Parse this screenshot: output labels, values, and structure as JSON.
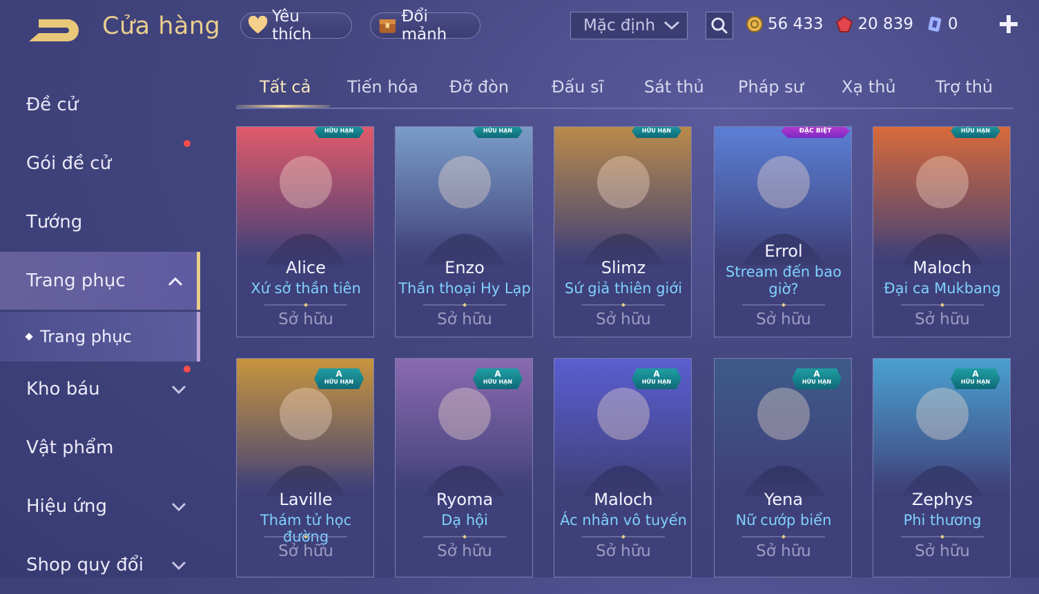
{
  "header": {
    "title": "Cửa hàng",
    "favorite_label": "Yêu thích",
    "shard_label": "Đổi mảnh",
    "sort_value": "Mặc định"
  },
  "currency": {
    "gold": "56 433",
    "vouchers": "20 839",
    "tickets": "0"
  },
  "sidebar": {
    "items": [
      {
        "label": "Đề cử"
      },
      {
        "label": "Gói đề cử"
      },
      {
        "label": "Tướng"
      },
      {
        "label": "Trang phục"
      },
      {
        "label": "Kho báu"
      },
      {
        "label": "Vật phẩm"
      },
      {
        "label": "Hiệu ứng"
      },
      {
        "label": "Shop quy đổi"
      }
    ],
    "sub_item": "Trang phục"
  },
  "tabs": [
    "Tất cả",
    "Tiến hóa",
    "Đỡ đòn",
    "Đấu sĩ",
    "Sát thủ",
    "Pháp sư",
    "Xạ thủ",
    "Trợ thủ"
  ],
  "cards": [
    {
      "hero": "Alice",
      "skin": "Xứ sở thần tiên",
      "status": "Sở hữu",
      "badge": "HỮU HẠN",
      "color": "#e05a6a"
    },
    {
      "hero": "Enzo",
      "skin": "Thần thoại Hy Lạp",
      "status": "Sở hữu",
      "badge": "HỮU HẠN",
      "color": "#7a9cc8"
    },
    {
      "hero": "Slimz",
      "skin": "Sứ giả thiên giới",
      "status": "Sở hữu",
      "badge": "HỮU HẠN",
      "color": "#b98a4a"
    },
    {
      "hero": "Errol",
      "skin": "Stream đến bao giờ?",
      "status": "Sở hữu",
      "badge": "ĐẶC BIỆT",
      "color": "#5b7fd6"
    },
    {
      "hero": "Maloch",
      "skin": "Đại ca Mukbang",
      "status": "Sở hữu",
      "badge": "HỮU HẠN",
      "color": "#d86a3a"
    },
    {
      "hero": "Laville",
      "skin": "Thám tử học đường",
      "status": "Sở hữu",
      "badge": "HỮU HẠN",
      "rank": "A",
      "color": "#c8953e"
    },
    {
      "hero": "Ryoma",
      "skin": "Dạ hội",
      "status": "Sở hữu",
      "badge": "HỮU HẠN",
      "rank": "A",
      "color": "#8a6ab0"
    },
    {
      "hero": "Maloch",
      "skin": "Ác nhân vô tuyến",
      "status": "Sở hữu",
      "badge": "HỮU HẠN",
      "rank": "A",
      "color": "#5a5ed0"
    },
    {
      "hero": "Yena",
      "skin": "Nữ cướp biển",
      "status": "Sở hữu",
      "badge": "HỮU HẠN",
      "rank": "A",
      "color": "#3e5a8a"
    },
    {
      "hero": "Zephys",
      "skin": "Phi thương",
      "status": "Sở hữu",
      "badge": "HỮU HẠN",
      "rank": "A",
      "color": "#4aa0d0"
    }
  ]
}
